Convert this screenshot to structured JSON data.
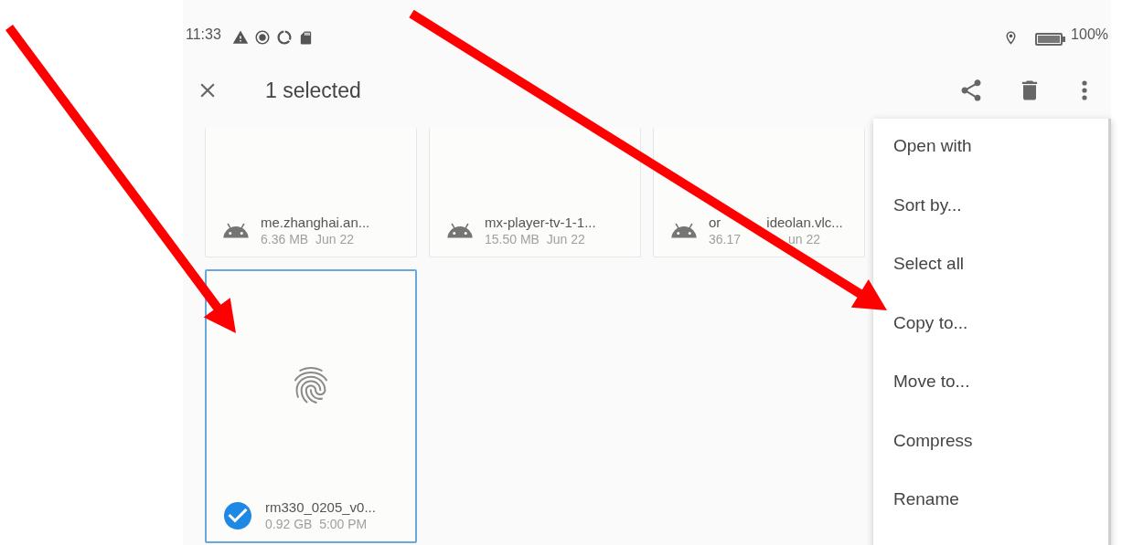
{
  "status_bar": {
    "time": "11:33",
    "battery": "100%"
  },
  "toolbar": {
    "title": "1 selected"
  },
  "files": [
    {
      "kind": "apk",
      "name": "me.zhanghai.an...",
      "meta": "6.36 MB  Jun 22",
      "selected": false
    },
    {
      "kind": "apk",
      "name": "mx-player-tv-1-1...",
      "meta": "15.50 MB  Jun 22",
      "selected": false
    },
    {
      "kind": "apk",
      "name": [
        "or",
        "ideolan.vlc..."
      ],
      "meta": [
        "36.17",
        "un 22"
      ],
      "selected": false
    },
    {
      "kind": "fingerprint",
      "name": "rm330_0205_v0...",
      "meta": "0.92 GB  5:00 PM",
      "selected": true
    }
  ],
  "menu": {
    "items": [
      "Open with",
      "Sort by...",
      "Select all",
      "Copy to...",
      "Move to...",
      "Compress",
      "Rename"
    ]
  }
}
